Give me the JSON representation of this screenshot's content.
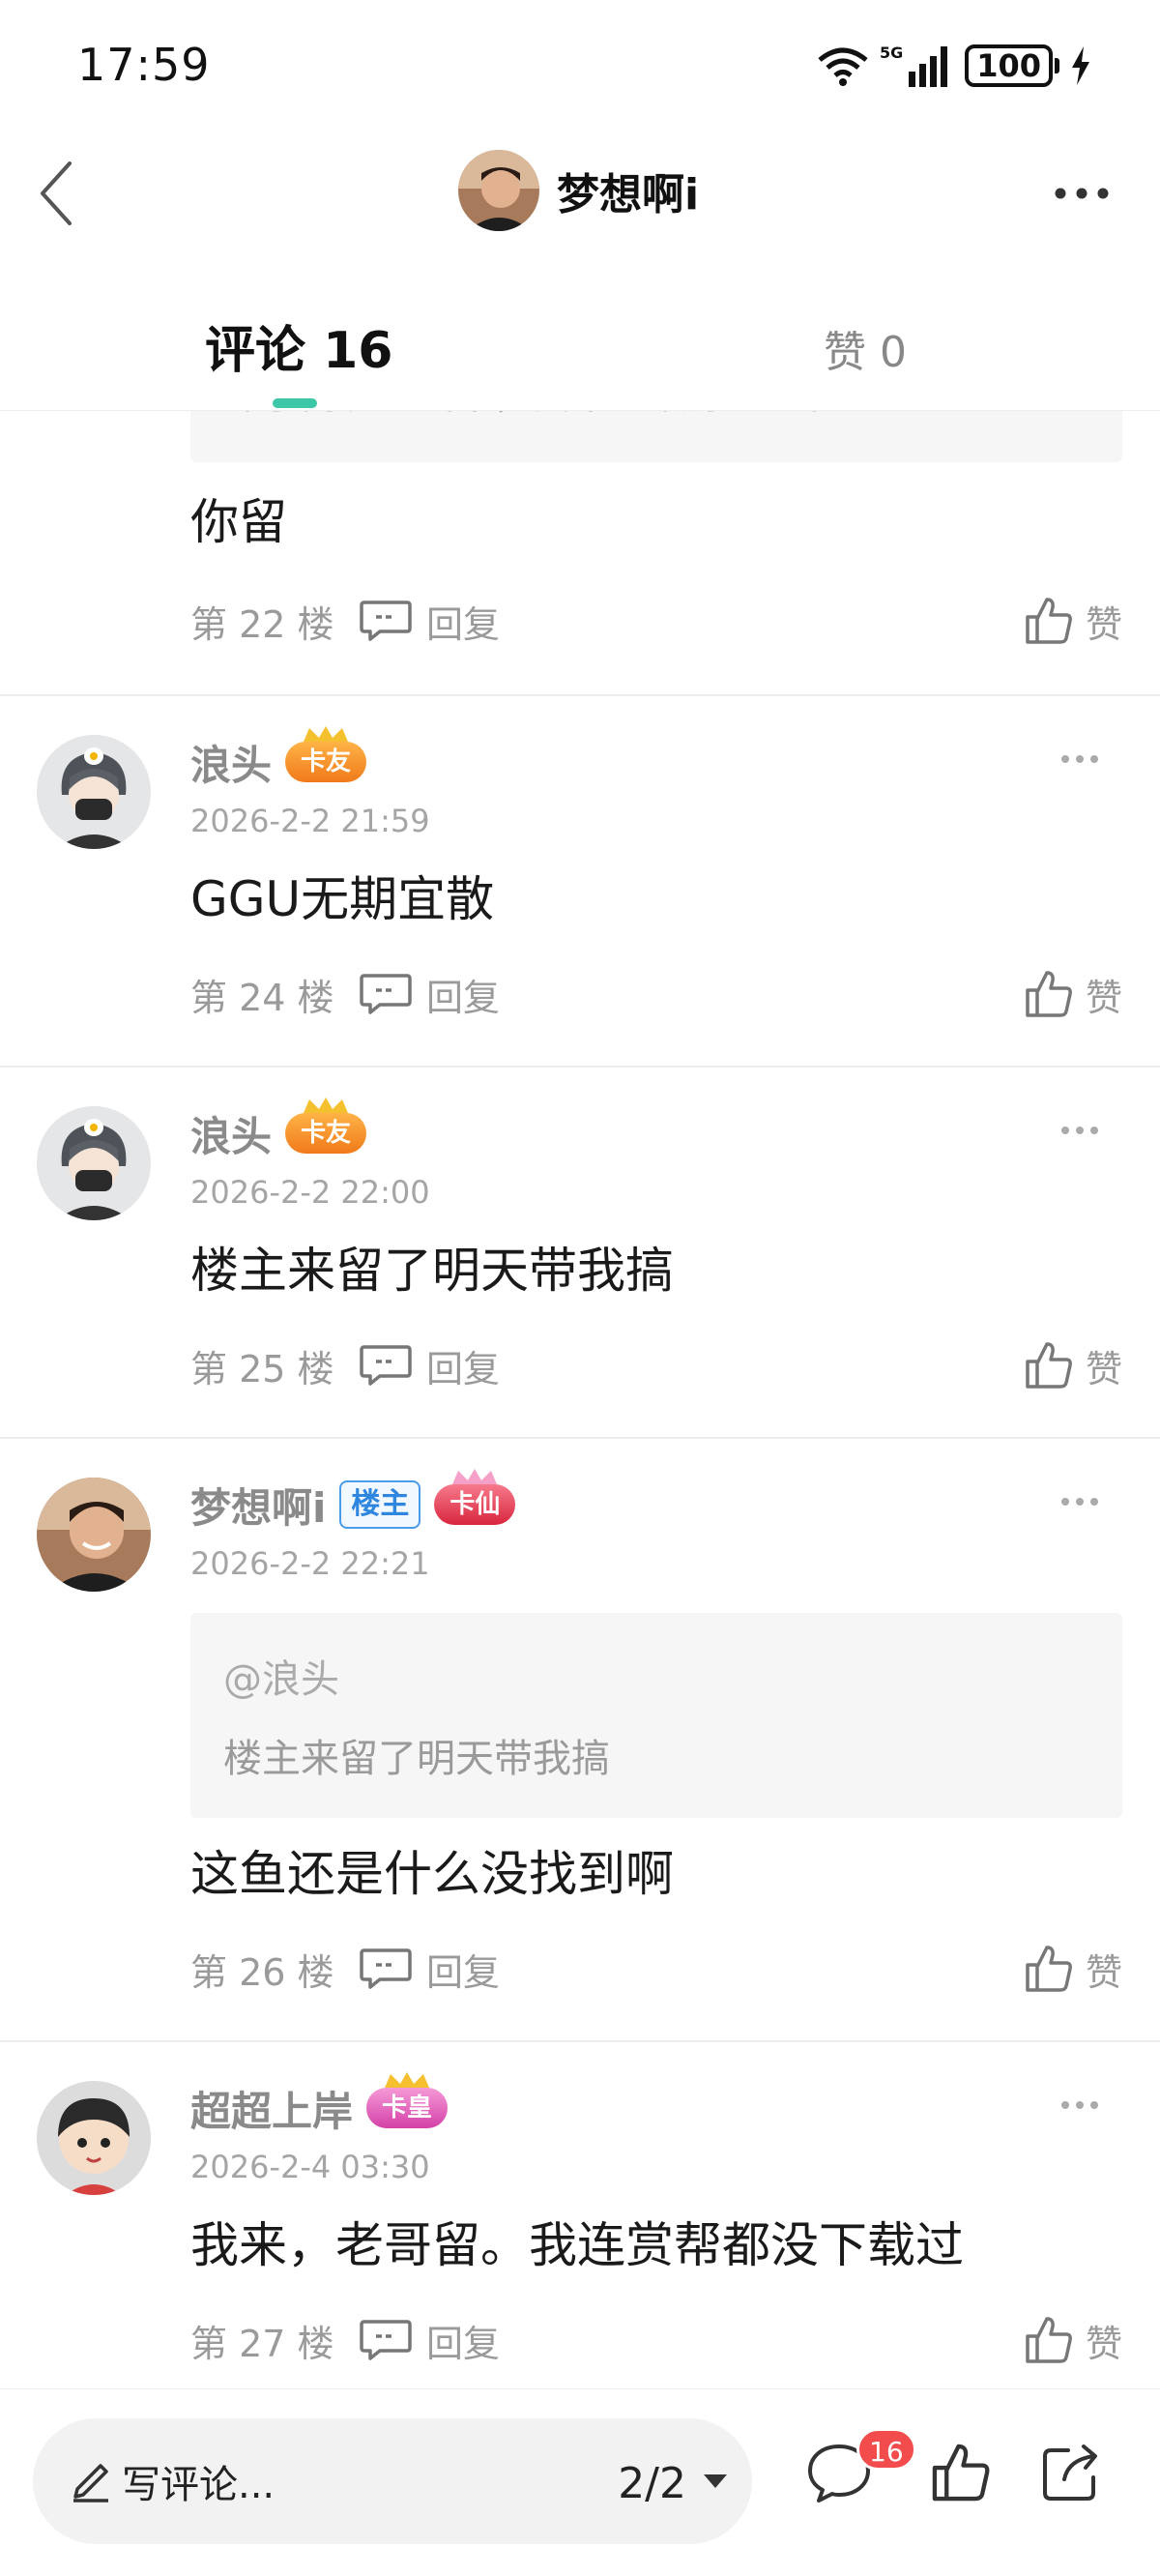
{
  "status_bar": {
    "time": "17:59",
    "battery": "100"
  },
  "header": {
    "username": "梦想啊i"
  },
  "tabs": {
    "comments_label": "评论 16",
    "likes_label": "赞 0"
  },
  "partial_comment": {
    "quote_stub": "冲了两次才出来，找不到最好的鱼和鲨鱼",
    "text": "你留",
    "floor": "第 22 楼",
    "reply_label": "回复",
    "like_label": "赞"
  },
  "comments": [
    {
      "username": "浪头",
      "badge": "卡友",
      "timestamp": "2026-2-2 21:59",
      "text": "GGU无期宜散",
      "floor": "第 24 楼",
      "reply_label": "回复",
      "like_label": "赞"
    },
    {
      "username": "浪头",
      "badge": "卡友",
      "timestamp": "2026-2-2 22:00",
      "text": "楼主来留了明天带我搞",
      "floor": "第 25 楼",
      "reply_label": "回复",
      "like_label": "赞"
    },
    {
      "username": "梦想啊i",
      "op_tag": "楼主",
      "badge": "卡仙",
      "timestamp": "2026-2-2 22:21",
      "quote_user": "@浪头",
      "quote_text": "楼主来留了明天带我搞",
      "text": "这鱼还是什么没找到啊",
      "floor": "第 26 楼",
      "reply_label": "回复",
      "like_label": "赞"
    },
    {
      "username": "超超上岸",
      "badge": "卡皇",
      "timestamp": "2026-2-4 03:30",
      "text": "我来，老哥留。我连赏帮都没下载过",
      "floor": "第 27 楼",
      "reply_label": "回复",
      "like_label": "赞"
    }
  ],
  "bottom_bar": {
    "input_placeholder": "写评论...",
    "page": "2/2",
    "comment_count_badge": "16"
  },
  "colors": {
    "accent": "#3ec7a6",
    "op_tag_blue": "#2e86de",
    "badge_red": "#f24c4c",
    "muted_text": "#9a9a9a"
  },
  "icons": [
    "back-arrow-icon",
    "more-dots-icon",
    "reply-bubble-icon",
    "thumbs-up-icon",
    "pencil-icon",
    "caret-down-icon",
    "comment-bubble-icon",
    "share-icon",
    "wifi-icon",
    "signal-icon",
    "charging-bolt-icon"
  ]
}
